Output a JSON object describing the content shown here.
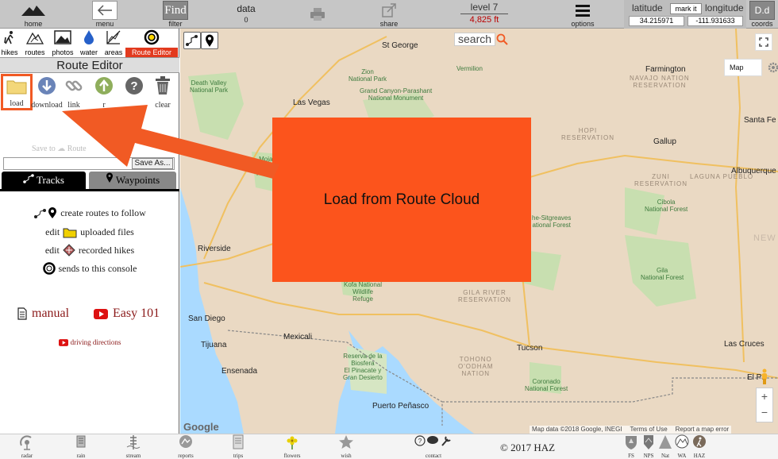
{
  "topbar": {
    "home_label": "home",
    "menu_label": "menu",
    "find_text": "Find",
    "filter_label": "filter",
    "data_label": "data",
    "data_count": "0",
    "share_label": "share",
    "level_text": "level 7",
    "elevation_text": "4,825 ft",
    "options_label": "options",
    "latitude_label": "latitude",
    "mark_it_label": "mark it",
    "longitude_label": "longitude",
    "latitude_value": "34.215971",
    "longitude_value": "-111.931633",
    "dd_text": "D.d",
    "coords_label": "coords"
  },
  "sidebar": {
    "layer_tabs": [
      "hikes",
      "routes",
      "photos",
      "water",
      "areas",
      "Route Editor"
    ],
    "title": "Route Editor",
    "tools": [
      "load",
      "download",
      "link",
      "r",
      "",
      "clear"
    ],
    "save_to_text": "Save to",
    "route_text": "Route",
    "save_as_label": "Save As...",
    "tab_tracks": "Tracks",
    "tab_waypoints": "Waypoints",
    "help_create": "create routes to follow",
    "help_edit1_pre": "edit",
    "help_edit1_post": "uploaded files",
    "help_edit2_pre": "edit",
    "help_edit2_post": "recorded hikes",
    "help_sends": "sends to this console",
    "manual_label": "manual",
    "easy_label": "Easy 101",
    "driving_label": "driving directions"
  },
  "map": {
    "overlay_text": "Load from Route Cloud",
    "search_label": "search",
    "map_type_label": "Map",
    "zoom_in": "+",
    "zoom_out": "−",
    "google_label": "Google",
    "attribution": "Map data ©2018 Google, INEGI",
    "terms_label": "Terms of Use",
    "report_label": "Report a map error",
    "cities": [
      {
        "name": "Las Vegas"
      },
      {
        "name": "St George"
      },
      {
        "name": "Farmington"
      },
      {
        "name": "Gallup"
      },
      {
        "name": "Albuquerque"
      },
      {
        "name": "Santa Fe"
      },
      {
        "name": "Riverside"
      },
      {
        "name": "San Diego"
      },
      {
        "name": "Tijuana"
      },
      {
        "name": "Mexicali"
      },
      {
        "name": "Ensenada"
      },
      {
        "name": "Tucson"
      },
      {
        "name": "Puerto Peñasco"
      },
      {
        "name": "Las Cruces"
      },
      {
        "name": "El Pa"
      }
    ],
    "parks": [
      {
        "name": "Death Valley\nNational Park"
      },
      {
        "name": "Zion\nNational Park"
      },
      {
        "name": "Grand Canyon-Parashant\nNational Monument"
      },
      {
        "name": "Cibola\nNational Forest"
      },
      {
        "name": "Kofa National\nWildlife\nRefuge"
      },
      {
        "name": "Gila\nNational Forest"
      },
      {
        "name": "Coronado\nNational Forest"
      },
      {
        "name": "Reserva de la\nBiosfera\nEl Pinacate y\nGran Desierto"
      },
      {
        "name": "Mojave\nNational\nPreserve"
      },
      {
        "name": "Vermilion"
      },
      {
        "name": "he-Sitgreaves\national Forest"
      }
    ],
    "reservations": [
      {
        "name": "NAVAJO NATION\nRESERVATION"
      },
      {
        "name": "HOPI\nRESERVATION"
      },
      {
        "name": "ZUNI\nRESERVATION"
      },
      {
        "name": "LAGUNA PUEBLO"
      },
      {
        "name": "GILA RIVER\nRESERVATION"
      },
      {
        "name": "TOHONO\nO'ODHAM\nNATION"
      },
      {
        "name": "NEW"
      }
    ]
  },
  "bottombar": {
    "items": [
      "radar",
      "rain",
      "stream",
      "reports",
      "trips",
      "flowers",
      "wish",
      "contact"
    ],
    "copyright": "© 2017 HAZ",
    "agency_items": [
      "FS",
      "NPS",
      "Nat",
      "WA",
      "HAZ"
    ]
  },
  "colors": {
    "accent": "#fc541c",
    "arrow": "#f15a24",
    "route_editor_tab": "#e23a1e",
    "link": "#8b1a1a",
    "elevation": "#bb0000"
  }
}
